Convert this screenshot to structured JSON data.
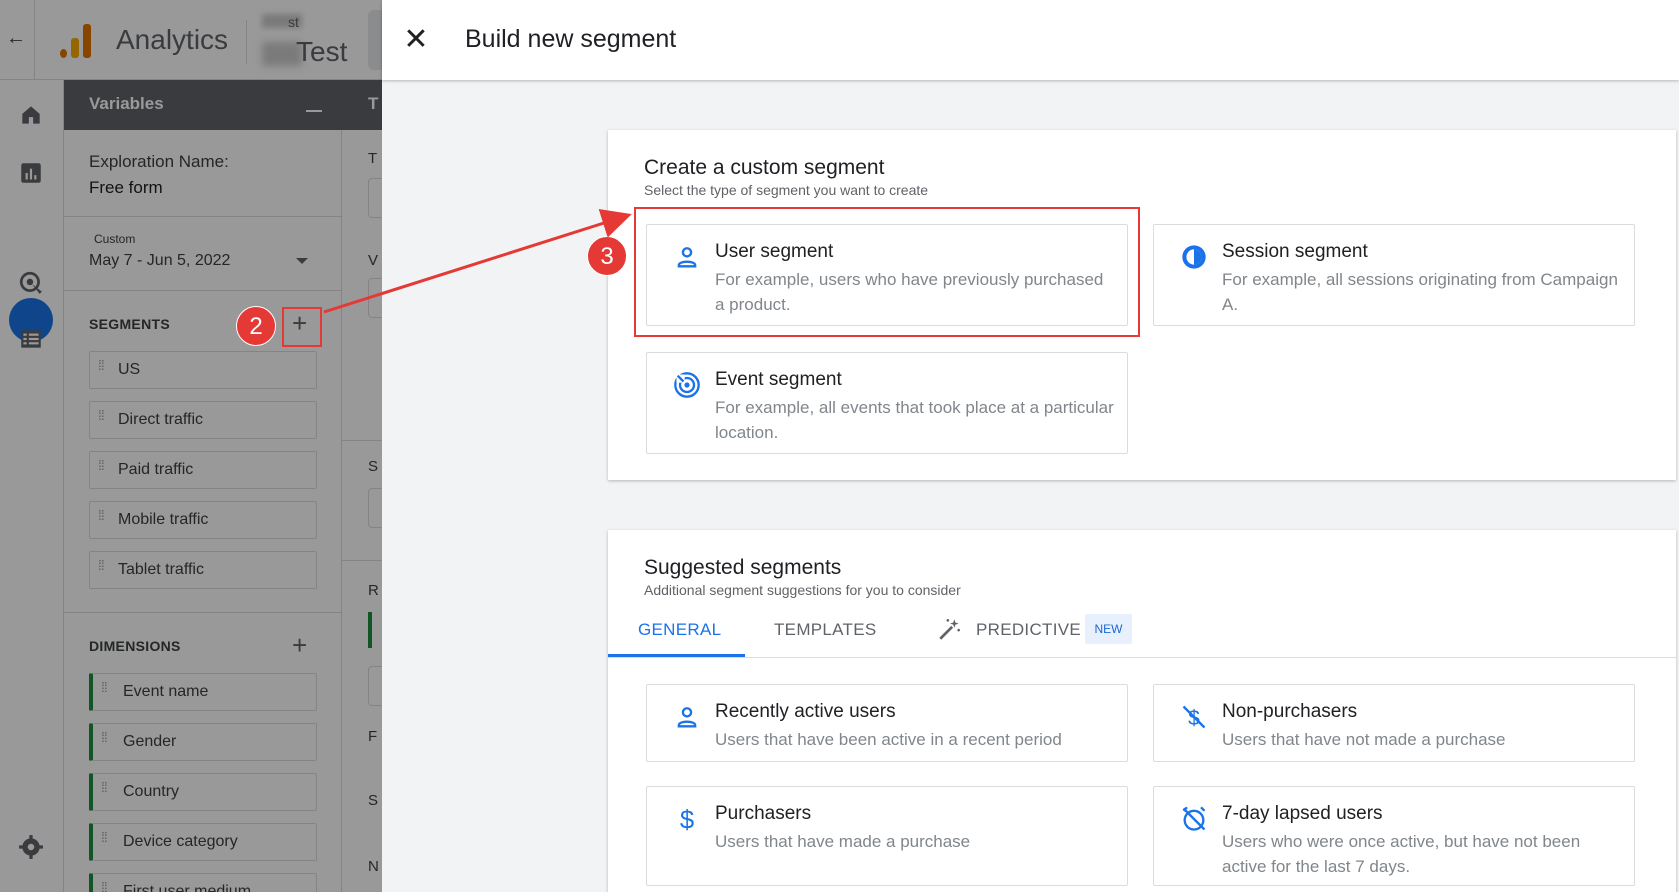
{
  "app": {
    "back_icon": "arrow-left-icon",
    "name": "Analytics",
    "property_small": "st",
    "property_large": "Test"
  },
  "variables": {
    "header": "Variables",
    "exploration_label": "Exploration Name:",
    "exploration_value": "Free form",
    "date_tag": "Custom",
    "date_range": "May 7 - Jun 5, 2022",
    "segments_title": "SEGMENTS",
    "segments": [
      "US",
      "Direct traffic",
      "Paid traffic",
      "Mobile traffic",
      "Tablet traffic"
    ],
    "dimensions_title": "DIMENSIONS",
    "dimensions": [
      "Event name",
      "Gender",
      "Country",
      "Device category",
      "First user medium"
    ]
  },
  "tab_settings": {
    "header": "T",
    "letters": [
      "T",
      "V",
      "S",
      "R",
      "F",
      "S",
      "N"
    ]
  },
  "overlay": {
    "title": "Build new segment",
    "custom": {
      "title": "Create a custom segment",
      "subtitle": "Select the type of segment you want to create",
      "options": [
        {
          "name": "User segment",
          "desc": "For example, users who have previously purchased a product.",
          "icon": "person-icon"
        },
        {
          "name": "Session segment",
          "desc": "For example, all sessions originating from Campaign A.",
          "icon": "session-icon"
        },
        {
          "name": "Event segment",
          "desc": "For example, all events that took place at a particular location.",
          "icon": "event-icon"
        }
      ]
    },
    "suggested": {
      "title": "Suggested segments",
      "subtitle": "Additional segment suggestions for you to consider",
      "tabs": [
        "GENERAL",
        "TEMPLATES",
        "PREDICTIVE"
      ],
      "new_badge": "NEW",
      "items": [
        {
          "name": "Recently active users",
          "desc": "Users that have been active in a recent period",
          "icon": "person-icon"
        },
        {
          "name": "Non-purchasers",
          "desc": "Users that have not made a purchase",
          "icon": "no-purchase-icon"
        },
        {
          "name": "Purchasers",
          "desc": "Users that have made a purchase",
          "icon": "dollar-icon"
        },
        {
          "name": "7-day lapsed users",
          "desc": "Users who were once active, but have not been active for the last 7 days.",
          "icon": "alarm-off-icon"
        }
      ]
    }
  },
  "annotations": {
    "step2": "2",
    "step3": "3",
    "color": "#e53935"
  },
  "colors": {
    "accent": "#1a73e8",
    "dimension_green": "#1e8e3e",
    "header_gray": "#5f6368"
  }
}
